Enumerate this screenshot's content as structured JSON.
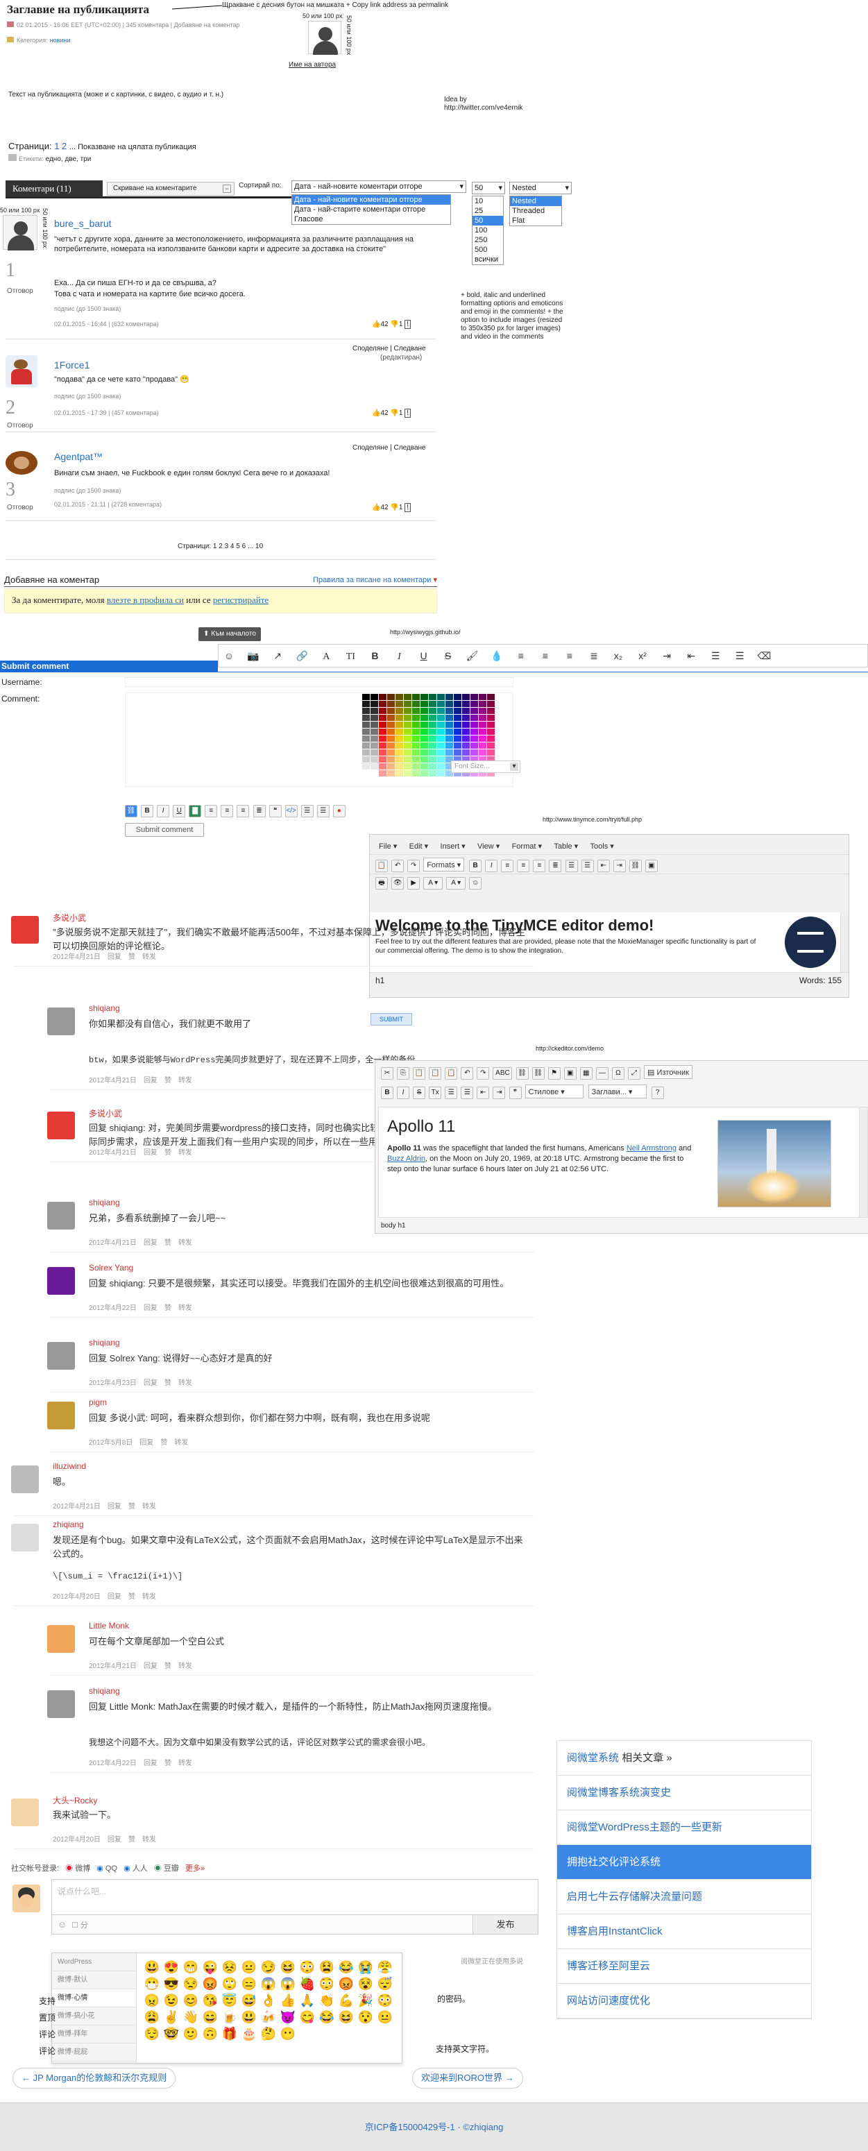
{
  "post": {
    "title": "Заглавие на публикацията",
    "meta": "02.01.2015 - 16:06 EET (UTC+02:00) | 345 коментара | Добавяне на коментар",
    "category_label": "Категория:",
    "category": "новини",
    "avatar_size": "50 или 100 px",
    "author_link": "Име на автора",
    "note_top": "Щракване с десния бутон на мишката + Copy link address за permalink",
    "body": "Текст на публикацията (може и с картинки, с видео, с аудио и т. н.)",
    "idea_label": "Idea by",
    "idea_url": "http://twitter.com/ve4ernik",
    "pages_label": "Страници:",
    "pages": "1 2",
    "pages_more": "... Показване на цялата публикация",
    "tags_label": "Етикети:",
    "tags": "едно, две, три"
  },
  "bar": {
    "comments": "Коментари (11)",
    "hide": "Скриване на коментарите",
    "sort_label": "Сортирай по:",
    "sort_value": "Дата - най-новите коментари отгоре",
    "sort_options": [
      "Дата - най-новите коментари отгоре",
      "Дата - най-старите коментари отгоре",
      "Гласове"
    ],
    "count_value": "50",
    "count_options": [
      "10",
      "25",
      "50",
      "100",
      "250",
      "500",
      "всички"
    ],
    "mode_value": "Nested",
    "mode_options": [
      "Nested",
      "Threaded",
      "Flat"
    ],
    "side_note": "+ bold, italic and underlined formatting options and emoticons and emoji in the comments! + the option to include images (resized to 350x350 px for larger images) and video in the comments"
  },
  "comments": [
    {
      "avatar_note": "50 или 100 px",
      "name": "bure_s_barut",
      "text": "\"четът с другите хора, данните за местоположението, информацията за различните разплащания на потребителите, номерата на използваните банкови карти и адресите за доставка на стоките\"",
      "text2": "Еха... Да си пиша ЕГН-то и да се свършва, а?",
      "text3": "Това с чата и номерата на картите бие всичко досега.",
      "sig": "подпис (до 1500 знака)",
      "meta": "02.01.2015 - 16:44 | (632 коментара)",
      "num": "1",
      "reply": "Отговор",
      "up": "42",
      "down": "1",
      "share": ""
    },
    {
      "name": "1Force1",
      "text": "\"подава\" да се чете като \"продава\"",
      "sig": "подпис (до 1500 знака)",
      "meta": "02.01.2015 - 17:39 | (457 коментара)",
      "num": "2",
      "reply": "Отговор",
      "up": "42",
      "down": "1",
      "share": "Споделяне | Следване",
      "edited": "(редактиран)"
    },
    {
      "name": "Agentpat™",
      "text": "Винаги съм знаел, че Fuckbook е един голям боклук! Сега вече го и доказаха!",
      "sig": "подпис (до 1500 знака)",
      "meta": "02.01.2015 - 21:11 | (2728 коментара)",
      "num": "3",
      "reply": "Отговор",
      "up": "42",
      "down": "1",
      "share": "Споделяне | Следване"
    }
  ],
  "pagination": "Страници: 1 2 3 4 5 6 ... 10",
  "add_comment": {
    "title": "Добавяне на коментар",
    "rules": "Правила за писане на коментари",
    "login_pre": "За да коментирате, моля",
    "login_link": "влезте в профила си",
    "login_mid": "или се",
    "register": "регистрирайте",
    "to_top": "Към началото"
  },
  "wysiwyg": {
    "url": "http://wysiwygjs.github.io/"
  },
  "submit": {
    "header": "Submit comment",
    "username": "Username:",
    "comment": "Comment:",
    "font_size": "Font Size...",
    "button": "Submit comment"
  },
  "tinymce": {
    "url": "http://www.tinymce.com/tryit/full.php",
    "menus": [
      "File",
      "Edit",
      "Insert",
      "View",
      "Format",
      "Table",
      "Tools"
    ],
    "formats": "Formats",
    "heading": "Welcome to the TinyMCE editor demo!",
    "body": "Feel free to try out the different features that are provided, please note that the MoxieManager specific functionality is part of our commercial offering. The demo is to show the integration.",
    "status_left": "h1",
    "words": "Words: 155",
    "submit": "SUBMIT"
  },
  "ckeditor": {
    "url": "http://ckeditor.com/demo",
    "source": "Източник",
    "styles": "Стилове",
    "headings": "Заглави...",
    "title": "Apollo 11",
    "body_pre": "Apollo 11",
    "body_text": "was the spaceflight that landed the first humans, Americans",
    "name1": "Neil Armstrong",
    "and": "and",
    "name2": "Buzz Aldrin",
    "body_tail": ", on the Moon on July 20, 1969, at 20:18 UTC. Armstrong became the first to step onto the lunar surface 6 hours later on July 21 at 02:56 UTC.",
    "path": "body  h1"
  },
  "cn": [
    {
      "name": "多说小武",
      "text": "\"多说服务说不定那天就挂了\"，我们确实不敢最坏能再活500年，不过对基本保障上，多说提供了评论实时同回，博客主可以切换回原始的评论框论。",
      "meta": [
        "2012年4月21日",
        "回复",
        "赞",
        "转发"
      ]
    },
    {
      "name": "shiqiang",
      "text": "你如果都没有自信心，我们就更不敢用了",
      "text2": "btw，如果多说能够与WordPress完美同步就更好了，现在还算不上同步，全一样的备份。",
      "meta": [
        "2012年4月21日",
        "回复",
        "赞",
        "转发"
      ]
    },
    {
      "name": "多说小武",
      "text": "回复 shiqiang: 对，完美同步需要wordpress的接口支持，同时也确实比较高。现在做到的同步，对于博客的实际同步需求，应该是开发上面我们有一些用户实现的同步，所以在一些用户实现的问题上。",
      "meta": [
        "2012年4月21日",
        "回复",
        "赞",
        "转发"
      ]
    },
    {
      "name": "shiqiang",
      "text": "兄弟，多看系统删掉了一会儿吧~~",
      "meta": [
        "2012年4月21日",
        "回复",
        "赞",
        "转发"
      ]
    },
    {
      "name": "Solrex Yang",
      "text": "回复 shiqiang: 只要不是很频繁，其实还可以接受。毕竟我们在国外的主机空间也很难达到很高的可用性。",
      "meta": [
        "2012年4月22日",
        "回复",
        "赞",
        "转发"
      ]
    },
    {
      "name": "shiqiang",
      "text": "回复 Solrex Yang: 说得好~~心态好才是真的好",
      "meta": [
        "2012年4月23日",
        "回复",
        "赞",
        "转发"
      ]
    },
    {
      "name": "pigm",
      "text": "回复 多说小武: 呵呵，看来群众想到你，你们都在努力中啊，既有啊，我也在用多说呢",
      "meta": [
        "2012年5月8日",
        "回复",
        "赞",
        "转发"
      ]
    },
    {
      "name": "illuziwind",
      "text": "嗯。",
      "meta": [
        "2012年4月21日",
        "回复",
        "赞",
        "转发"
      ]
    },
    {
      "name": "zhiqiang",
      "text": "发现还是有个bug。如果文章中没有LaTeX公式，这个页面就不会启用MathJax，这时候在评论中写LaTeX是显示不出来公式的。",
      "text2": "\\[\\sum_i = \\frac12i(i+1)\\]",
      "meta": [
        "2012年4月20日",
        "回复",
        "赞",
        "转发"
      ]
    },
    {
      "name": "Little Monk",
      "text": "可在每个文章尾部加一个空白公式",
      "meta": [
        "2012年4月21日",
        "回复",
        "赞",
        "转发"
      ]
    },
    {
      "name": "shiqiang",
      "text": "回复 Little Monk: MathJax在需要的时候才载入，是插件的一个新特性，防止MathJax拖网页速度拖慢。",
      "text2": "我想这个问题不大。因为文章中如果没有数学公式的话，评论区对数学公式的需求会很小吧。",
      "meta": [
        "2012年4月22日",
        "回复",
        "赞",
        "转发"
      ]
    },
    {
      "name": "大头~Rocky",
      "text": "我来试验一下。",
      "meta": [
        "2012年4月20日",
        "回复",
        "赞",
        "转发"
      ]
    }
  ],
  "social": {
    "label": "社交帐号登录:",
    "items": [
      "微博",
      "QQ",
      "人人",
      "豆瓣",
      "更多»"
    ]
  },
  "cbox": {
    "placeholder": "说点什么吧...",
    "share": "分",
    "publish": "发布",
    "powered": "阅微堂正在使用多说"
  },
  "emoji_tabs": [
    "WordPress",
    "微博-默认",
    "微博-心情",
    "微博-搞小花",
    "微博-拜年",
    "微博-屁屁"
  ],
  "emojis": [
    "😃",
    "😍",
    "😁",
    "😜",
    "😣",
    "😐",
    "😏",
    "😆",
    "😳",
    "😫",
    "😂",
    "😭",
    "😤",
    "😷",
    "😎",
    "😒",
    "😡",
    "🙄",
    "😑",
    "😱",
    "😱",
    "🍓",
    "😳",
    "😡",
    "😵",
    "😴",
    "😠",
    "😉",
    "😊",
    "😘",
    "😇",
    "😅",
    "👌",
    "👍",
    "🙏",
    "👏",
    "💪",
    "🎉",
    "😳",
    "😩",
    "✌",
    "👋",
    "😄",
    "🍺",
    "😃",
    "🍻",
    "😈",
    "😋",
    "😂",
    "😆",
    "😯",
    "😐",
    "😌",
    "🤓",
    "🙂",
    "🙃",
    "🎁",
    "🎂",
    "🤔",
    "😶"
  ],
  "notes": [
    "支持",
    "置顶",
    "评论",
    "评论"
  ],
  "note_tail": [
    "的密码。",
    "支持英文字符。"
  ],
  "nav": {
    "prev": "JP Morgan的伦敦鲸和沃尔克规则",
    "next": "欢迎来到RORO世界"
  },
  "footer": "京ICP备15000429号-1 · ©zhiqiang",
  "side": {
    "title": "阅微堂系统",
    "title_tail": "相关文章 »",
    "items": [
      "阅微堂博客系统演变史",
      "阅微堂WordPress主题的一些更新",
      "拥抱社交化评论系统",
      "启用七牛云存储解决流量问题",
      "博客启用InstantClick",
      "博客迁移至阿里云",
      "网站访问速度优化"
    ],
    "active": 2
  }
}
